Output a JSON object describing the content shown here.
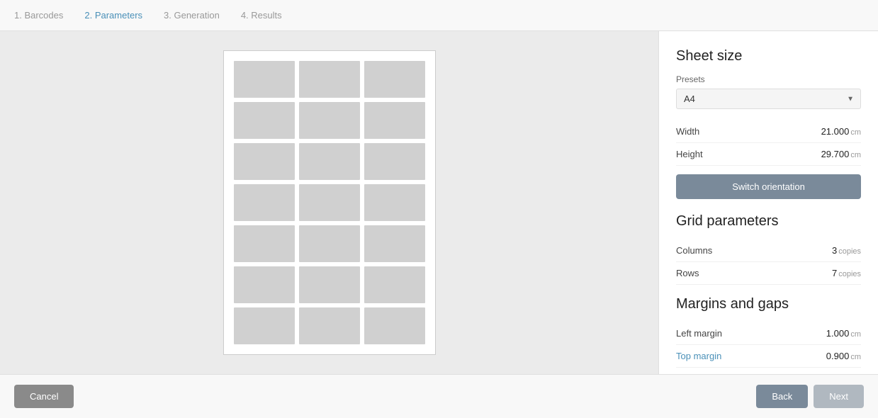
{
  "nav": {
    "steps": [
      {
        "label": "1. Barcodes",
        "active": false
      },
      {
        "label": "2. Parameters",
        "active": true
      },
      {
        "label": "3. Generation",
        "active": false
      },
      {
        "label": "4. Results",
        "active": false
      }
    ]
  },
  "sheet_size": {
    "title": "Sheet size",
    "presets_label": "Presets",
    "preset_value": "A4",
    "width_label": "Width",
    "width_value": "21.000",
    "width_unit": "cm",
    "height_label": "Height",
    "height_value": "29.700",
    "height_unit": "cm",
    "switch_btn_label": "Switch orientation"
  },
  "grid_params": {
    "title": "Grid parameters",
    "columns_label": "Columns",
    "columns_value": "3",
    "columns_unit": "copies",
    "rows_label": "Rows",
    "rows_value": "7",
    "rows_unit": "copies"
  },
  "margins": {
    "title": "Margins and gaps",
    "left_margin_label": "Left margin",
    "left_margin_value": "1.000",
    "left_margin_unit": "cm",
    "top_margin_label": "Top margin",
    "top_margin_value": "0.900",
    "top_margin_unit": "cm"
  },
  "bottom_bar": {
    "cancel_label": "Cancel",
    "back_label": "Back",
    "next_label": "Next"
  },
  "grid": {
    "rows": 7,
    "cols": 3
  }
}
